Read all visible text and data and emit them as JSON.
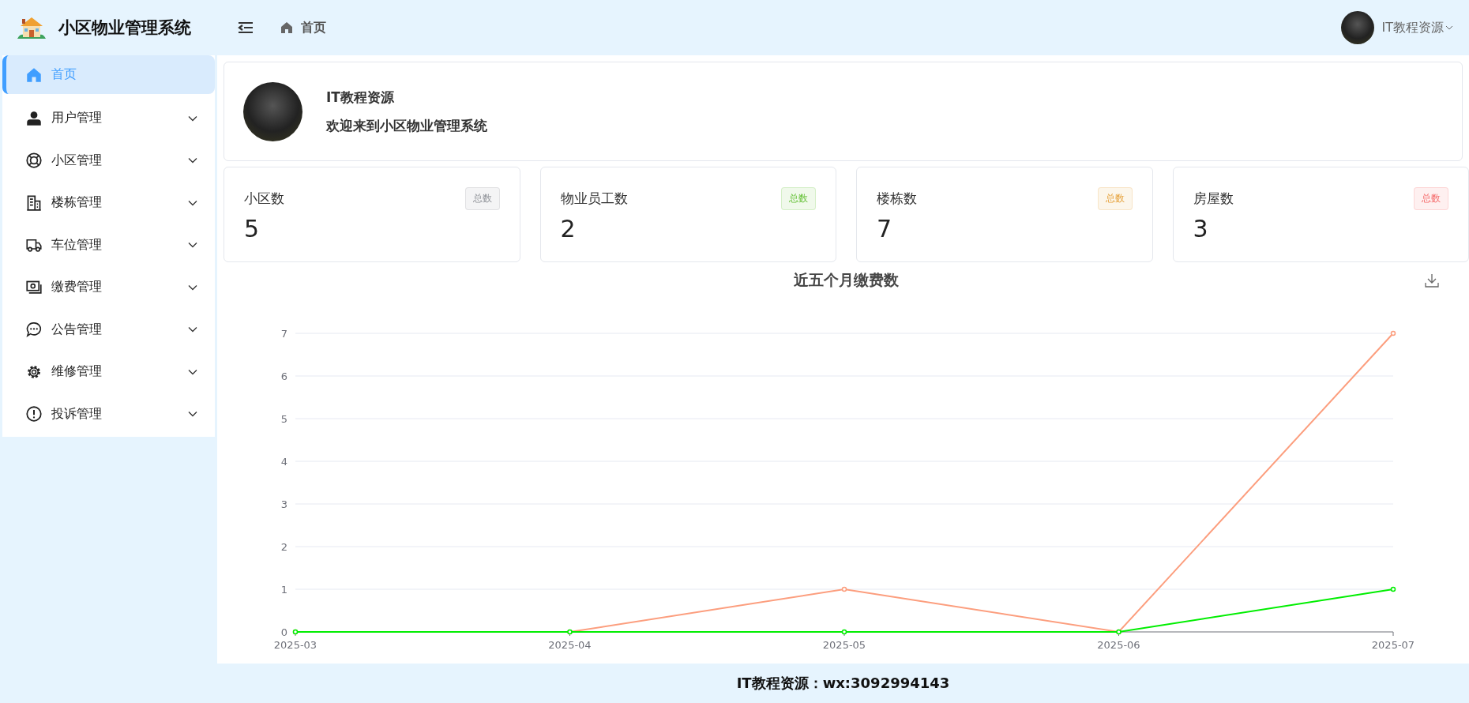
{
  "app": {
    "title": "小区物业管理系统"
  },
  "header": {
    "breadcrumb": "首页",
    "user": "IT教程资源"
  },
  "sidebar": {
    "items": [
      {
        "label": "首页",
        "selected": true,
        "expandable": false
      },
      {
        "label": "用户管理",
        "selected": false,
        "expandable": true
      },
      {
        "label": "小区管理",
        "selected": false,
        "expandable": true
      },
      {
        "label": "楼栋管理",
        "selected": false,
        "expandable": true
      },
      {
        "label": "车位管理",
        "selected": false,
        "expandable": true
      },
      {
        "label": "缴费管理",
        "selected": false,
        "expandable": true
      },
      {
        "label": "公告管理",
        "selected": false,
        "expandable": true
      },
      {
        "label": "维修管理",
        "selected": false,
        "expandable": true
      },
      {
        "label": "投诉管理",
        "selected": false,
        "expandable": true
      }
    ]
  },
  "welcome": {
    "name": "IT教程资源",
    "message": "欢迎来到小区物业管理系统"
  },
  "stats": [
    {
      "label": "小区数",
      "value": "5",
      "tag": "总数",
      "color": "#909399"
    },
    {
      "label": "物业员工数",
      "value": "2",
      "tag": "总数",
      "color": "#67c23a"
    },
    {
      "label": "楼栋数",
      "value": "7",
      "tag": "总数",
      "color": "#e6a23c"
    },
    {
      "label": "房屋数",
      "value": "3",
      "tag": "总数",
      "color": "#f56c6c"
    }
  ],
  "chart": {
    "title": "近五个月缴费数",
    "chart_data": {
      "type": "line",
      "categories": [
        "2025-03",
        "2025-04",
        "2025-05",
        "2025-06",
        "2025-07"
      ],
      "series": [
        {
          "color": "#fc9e7e",
          "marker": true,
          "values": [
            0,
            0,
            1,
            0,
            7
          ]
        },
        {
          "color": "#00ee00",
          "marker": true,
          "values": [
            0,
            0,
            0,
            0,
            1
          ]
        }
      ],
      "ylim": [
        0,
        7
      ],
      "yticks": [
        0,
        1,
        2,
        3,
        4,
        5,
        6,
        7
      ],
      "grid": true
    }
  },
  "footer": {
    "text": "IT教程资源：wx:3092994143"
  }
}
